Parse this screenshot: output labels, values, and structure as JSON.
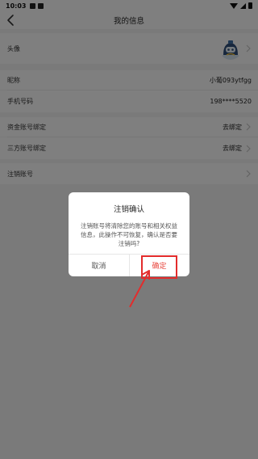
{
  "status_bar": {
    "time": "10:03"
  },
  "header": {
    "title": "我的信息"
  },
  "rows": {
    "avatar": {
      "label": "头像"
    },
    "nickname": {
      "label": "昵称",
      "value": "小葡093ytfgg"
    },
    "phone": {
      "label": "手机号码",
      "value": "198****5520"
    },
    "fund_account": {
      "label": "资金账号绑定",
      "value": "去绑定"
    },
    "third_party": {
      "label": "三方账号绑定",
      "value": "去绑定"
    },
    "cancel_account": {
      "label": "注销账号"
    }
  },
  "dialog": {
    "title": "注销确认",
    "message": "注销账号将清除您的账号和相关权益信息，此操作不可恢复，确认是否要注销吗?",
    "cancel_label": "取消",
    "confirm_label": "确定"
  },
  "colors": {
    "confirm": "#e8453c",
    "annotation": "#e32c2c",
    "overlay": "rgba(0,0,0,0.5)"
  },
  "icons": [
    "back-arrow-icon",
    "chevron-right-icon",
    "avatar-mascot-icon",
    "annotation-arrow-icon"
  ]
}
